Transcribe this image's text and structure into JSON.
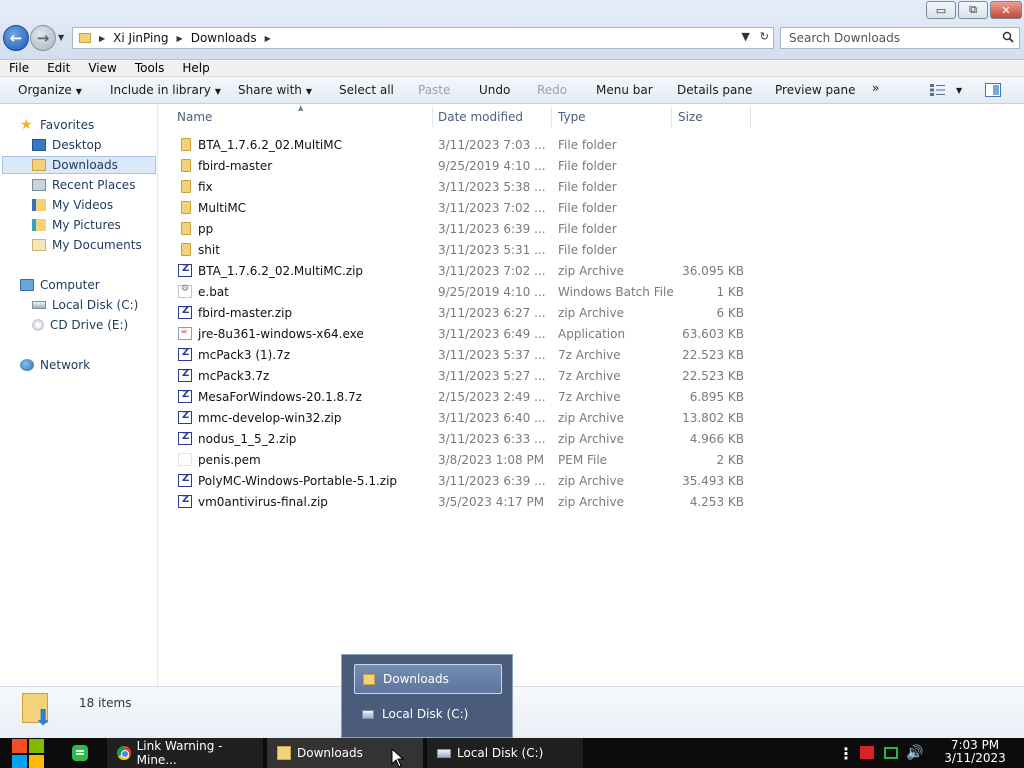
{
  "window": {
    "controls": {
      "minimize": "▭",
      "restore": "⧉",
      "close": "✕"
    }
  },
  "address_bar": {
    "crumbs": [
      "Xi JinPing",
      "Downloads"
    ]
  },
  "search": {
    "placeholder": "Search Downloads"
  },
  "menu": [
    "File",
    "Edit",
    "View",
    "Tools",
    "Help"
  ],
  "toolbar": {
    "organize": "Organize",
    "include_in_library": "Include in library",
    "share_with": "Share with",
    "select_all": "Select all",
    "paste": "Paste",
    "undo": "Undo",
    "redo": "Redo",
    "menu_bar": "Menu bar",
    "details_pane": "Details pane",
    "preview_pane": "Preview pane",
    "more": "»"
  },
  "navigation": {
    "favorites": "Favorites",
    "favorites_items": [
      "Desktop",
      "Downloads",
      "Recent Places",
      "My Videos",
      "My Pictures",
      "My Documents"
    ],
    "selected": "Downloads",
    "computer": "Computer",
    "computer_items": [
      "Local Disk (C:)",
      "CD Drive (E:)"
    ],
    "network": "Network"
  },
  "columns": [
    "Name",
    "Date modified",
    "Type",
    "Size"
  ],
  "files": [
    {
      "name": "BTA_1.7.6.2_02.MultiMC",
      "date": "3/11/2023 7:03 ...",
      "type": "File folder",
      "size": "",
      "icon": "folder-icon"
    },
    {
      "name": "fbird-master",
      "date": "9/25/2019 4:10 ...",
      "type": "File folder",
      "size": "",
      "icon": "folder-icon"
    },
    {
      "name": "fix",
      "date": "3/11/2023 5:38 ...",
      "type": "File folder",
      "size": "",
      "icon": "folder-icon"
    },
    {
      "name": "MultiMC",
      "date": "3/11/2023 7:02 ...",
      "type": "File folder",
      "size": "",
      "icon": "folder-icon"
    },
    {
      "name": "pp",
      "date": "3/11/2023 6:39 ...",
      "type": "File folder",
      "size": "",
      "icon": "folder-icon"
    },
    {
      "name": "shit",
      "date": "3/11/2023 5:31 ...",
      "type": "File folder",
      "size": "",
      "icon": "folder-icon"
    },
    {
      "name": "BTA_1.7.6.2_02.MultiMC.zip",
      "date": "3/11/2023 7:02 ...",
      "type": "zip Archive",
      "size": "36.095 KB",
      "icon": "archive-icon"
    },
    {
      "name": "e.bat",
      "date": "9/25/2019 4:10 ...",
      "type": "Windows Batch File",
      "size": "1 KB",
      "icon": "batch-file-icon"
    },
    {
      "name": "fbird-master.zip",
      "date": "3/11/2023 6:27 ...",
      "type": "zip Archive",
      "size": "6 KB",
      "icon": "archive-icon"
    },
    {
      "name": "jre-8u361-windows-x64.exe",
      "date": "3/11/2023 6:49 ...",
      "type": "Application",
      "size": "63.603 KB",
      "icon": "java-installer-icon"
    },
    {
      "name": "mcPack3 (1).7z",
      "date": "3/11/2023 5:37 ...",
      "type": "7z Archive",
      "size": "22.523 KB",
      "icon": "archive-icon"
    },
    {
      "name": "mcPack3.7z",
      "date": "3/11/2023 5:27 ...",
      "type": "7z Archive",
      "size": "22.523 KB",
      "icon": "archive-icon"
    },
    {
      "name": "MesaForWindows-20.1.8.7z",
      "date": "2/15/2023 2:49 ...",
      "type": "7z Archive",
      "size": "6.895 KB",
      "icon": "archive-icon"
    },
    {
      "name": "mmc-develop-win32.zip",
      "date": "3/11/2023 6:40 ...",
      "type": "zip Archive",
      "size": "13.802 KB",
      "icon": "archive-icon"
    },
    {
      "name": "nodus_1_5_2.zip",
      "date": "3/11/2023 6:33 ...",
      "type": "zip Archive",
      "size": "4.966 KB",
      "icon": "archive-icon"
    },
    {
      "name": "penis.pem",
      "date": "3/8/2023 1:08 PM",
      "type": "PEM File",
      "size": "2 KB",
      "icon": "blank-file-icon"
    },
    {
      "name": "PolyMC-Windows-Portable-5.1.zip",
      "date": "3/11/2023 6:39 ...",
      "type": "zip Archive",
      "size": "35.493 KB",
      "icon": "archive-icon"
    },
    {
      "name": "vm0antivirus-final.zip",
      "date": "3/5/2023 4:17 PM",
      "type": "zip Archive",
      "size": "4.253 KB",
      "icon": "archive-icon"
    }
  ],
  "status": {
    "items_count": "18 items"
  },
  "taskbar": {
    "buttons": [
      "Link Warning - Mine...",
      "Downloads",
      "Local Disk (C:)"
    ],
    "active": "Downloads",
    "clock_time": "7:03 PM",
    "clock_date": "3/11/2023"
  },
  "taskbar_popup": {
    "items": [
      "Downloads",
      "Local Disk (C:)"
    ],
    "highlighted": "Downloads"
  }
}
